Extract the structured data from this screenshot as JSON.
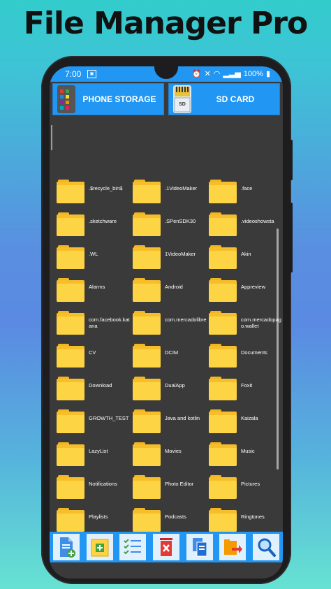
{
  "promo": {
    "title": "File Manager Pro"
  },
  "statusbar": {
    "time": "7:00",
    "battery": "100%"
  },
  "storage": {
    "phone_label": "PHONE STORAGE",
    "sd_label": "SD CARD",
    "sd_img_text": "SD"
  },
  "folders": [
    ".$recycle_bin$",
    ".1VideoMaker",
    ".face",
    ".sketchware",
    ".SPenSDK30",
    ".videoshowsta",
    ".WL",
    "1VideoMaker",
    "Akin",
    "Alarms",
    "Android",
    "Appreview",
    "com.facebook.katana",
    "com.mercadolibre",
    "com.mercadopago.wallet",
    "CV",
    "DCIM",
    "Documents",
    "Download",
    "DualApp",
    "Foxit",
    "GROWTH_TEST",
    "Java and kotlin",
    "Kaizala",
    "LazyList",
    "Movies",
    "Music",
    "Notifications",
    "Photo Editor",
    "Pictures",
    "Playlists",
    "Podcasts",
    "Ringtones"
  ],
  "toolbar": {
    "buttons": [
      "new-file-icon",
      "new-folder-icon",
      "select-list-icon",
      "delete-icon",
      "copy-icon",
      "move-icon",
      "search-icon"
    ]
  },
  "colors": {
    "accent": "#2196f3",
    "folder": "#fdd443",
    "screen_bg": "#3a3a3a"
  }
}
